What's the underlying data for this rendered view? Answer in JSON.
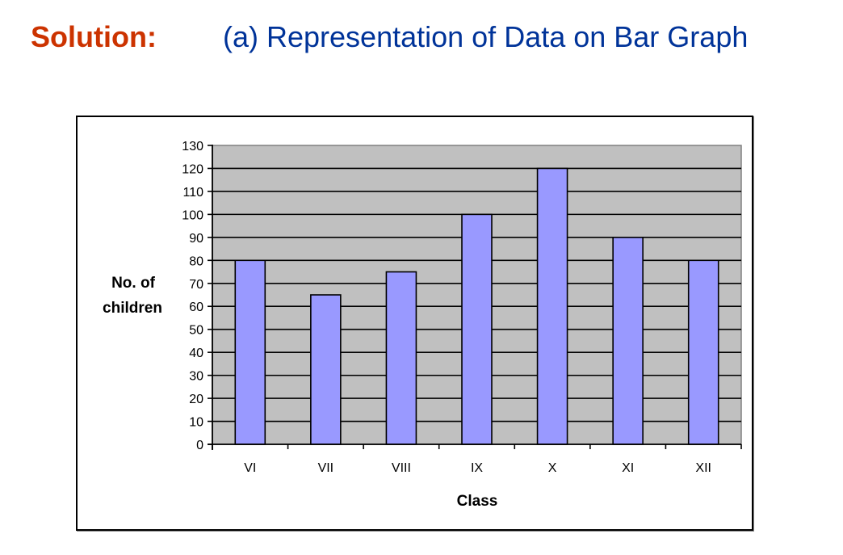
{
  "heading": {
    "label": "Solution:",
    "title": "(a) Representation of Data on Bar Graph"
  },
  "colors": {
    "label_color": "#cc3300",
    "title_color": "#003399",
    "plot_background": "#c0c0c0",
    "bar_fill": "#9999ff",
    "bar_stroke": "#000000",
    "gridline": "#000000"
  },
  "chart_data": {
    "type": "bar",
    "title": "",
    "xlabel": "Class",
    "ylabel": [
      "No. of",
      "children"
    ],
    "categories": [
      "VI",
      "VII",
      "VIII",
      "IX",
      "X",
      "XI",
      "XII"
    ],
    "values": [
      80,
      65,
      75,
      100,
      120,
      90,
      80
    ],
    "ylim": [
      0,
      130
    ],
    "y_ticks": [
      0,
      10,
      20,
      30,
      40,
      50,
      60,
      70,
      80,
      90,
      100,
      110,
      120,
      130
    ],
    "grid": true,
    "legend": "none"
  }
}
